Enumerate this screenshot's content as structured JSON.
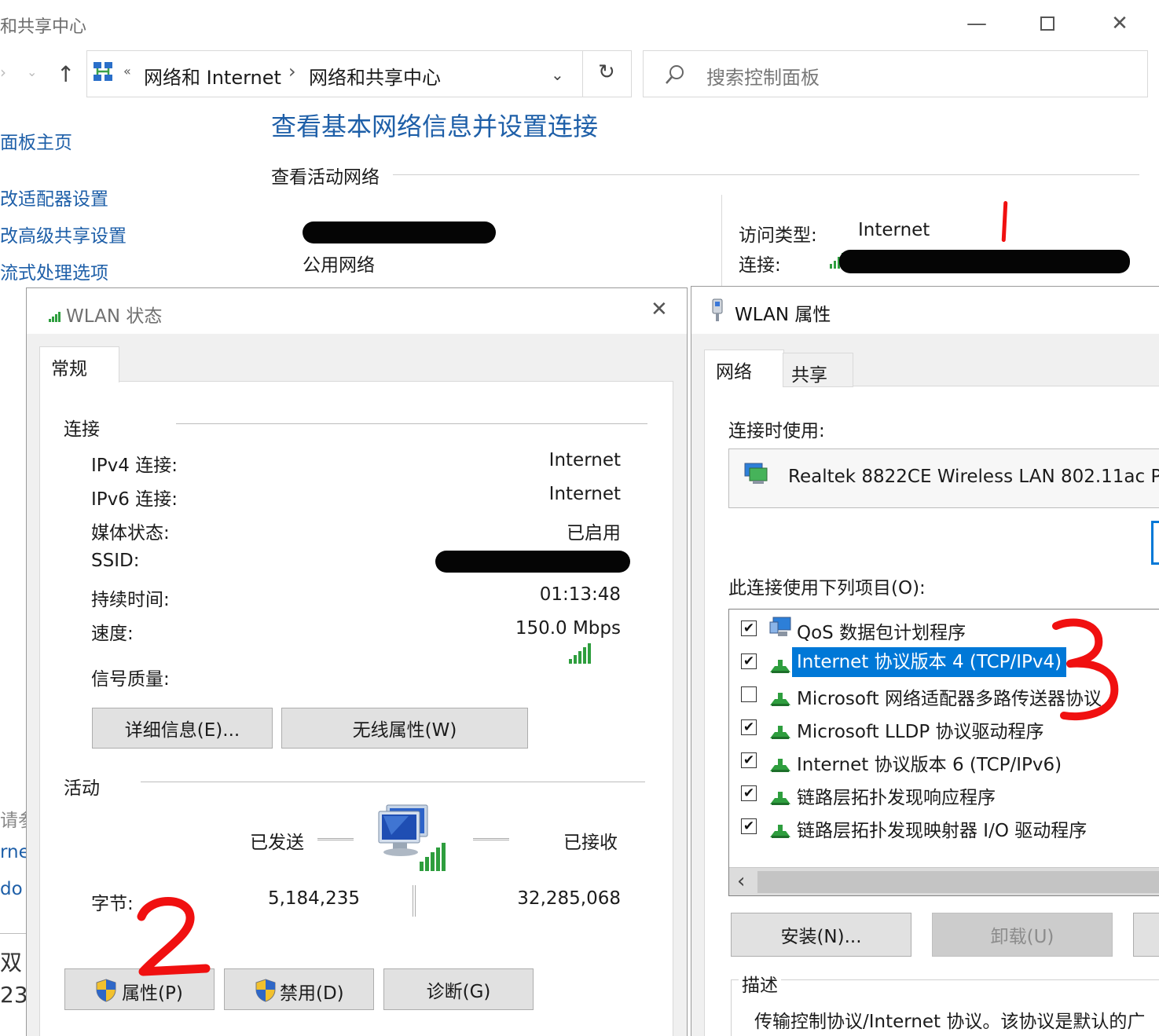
{
  "bg_window": {
    "title": "和共享中心",
    "breadcrumb": {
      "prefix": "«",
      "part1": "网络和 Internet",
      "separator": "›",
      "part2": "网络和共享中心"
    },
    "search_placeholder": "搜索控制面板",
    "main_title": "查看基本网络信息并设置连接",
    "active_networks_label": "查看活动网络",
    "network_type": "公用网络",
    "access_type_label": "访问类型:",
    "access_type_value": "Internet",
    "connection_label": "连接:",
    "left_links": [
      "面板主页",
      "改适配器设置",
      "改高级共享设置",
      "流式处理选项"
    ],
    "left_fragments": [
      "请参",
      "rne",
      "do",
      "双",
      "23."
    ]
  },
  "status_dialog": {
    "title": "WLAN 状态",
    "tab": "常规",
    "connection_group": "连接",
    "rows": [
      {
        "label": "IPv4 连接:",
        "value": "Internet"
      },
      {
        "label": "IPv6 连接:",
        "value": "Internet"
      },
      {
        "label": "媒体状态:",
        "value": "已启用"
      },
      {
        "label": "SSID:",
        "value": ""
      },
      {
        "label": "持续时间:",
        "value": "01:13:48"
      },
      {
        "label": "速度:",
        "value": "150.0 Mbps"
      }
    ],
    "signal_label": "信号质量:",
    "signal_bars": 5,
    "details_button": "详细信息(E)...",
    "wireless_props_button": "无线属性(W)",
    "activity_group": "活动",
    "sent_label": "已发送",
    "received_label": "已接收",
    "bytes_label": "字节:",
    "bytes_sent": "5,184,235",
    "bytes_received": "32,285,068",
    "properties_button": "属性(P)",
    "disable_button": "禁用(D)",
    "diagnose_button": "诊断(G)"
  },
  "props_dialog": {
    "title": "WLAN 属性",
    "tabs": [
      "网络",
      "共享"
    ],
    "connect_using_label": "连接时使用:",
    "adapter_name": "Realtek 8822CE Wireless LAN 802.11ac P",
    "items_label": "此连接使用下列项目(O):",
    "items": [
      {
        "label": "QoS 数据包计划程序",
        "checked": "✔",
        "icon": "qos-scheduler-icon"
      },
      {
        "label": "Internet 协议版本 4 (TCP/IPv4)",
        "checked": "✔",
        "icon": "protocol-icon",
        "selected": true
      },
      {
        "label": "Microsoft 网络适配器多路传送器协议",
        "checked": "",
        "icon": "protocol-icon"
      },
      {
        "label": "Microsoft LLDP 协议驱动程序",
        "checked": "✔",
        "icon": "protocol-icon"
      },
      {
        "label": "Internet 协议版本 6 (TCP/IPv6)",
        "checked": "✔",
        "icon": "protocol-icon"
      },
      {
        "label": "链路层拓扑发现响应程序",
        "checked": "✔",
        "icon": "protocol-icon"
      },
      {
        "label": "链路层拓扑发现映射器 I/O 驱动程序",
        "checked": "✔",
        "icon": "protocol-icon"
      }
    ],
    "scroll_left": "‹",
    "install_button": "安装(N)...",
    "uninstall_button": "卸载(U)",
    "description_group": "描述",
    "description_text": "传输控制协议/Internet 协议。该协议是默认的广"
  },
  "annotations": {
    "mark1": "1",
    "mark2": "2",
    "mark3": "3"
  },
  "colors": {
    "link": "#1e5fa8",
    "selection": "#0078d7",
    "annotation": "#f01010",
    "signal": "#2e9e3e"
  }
}
